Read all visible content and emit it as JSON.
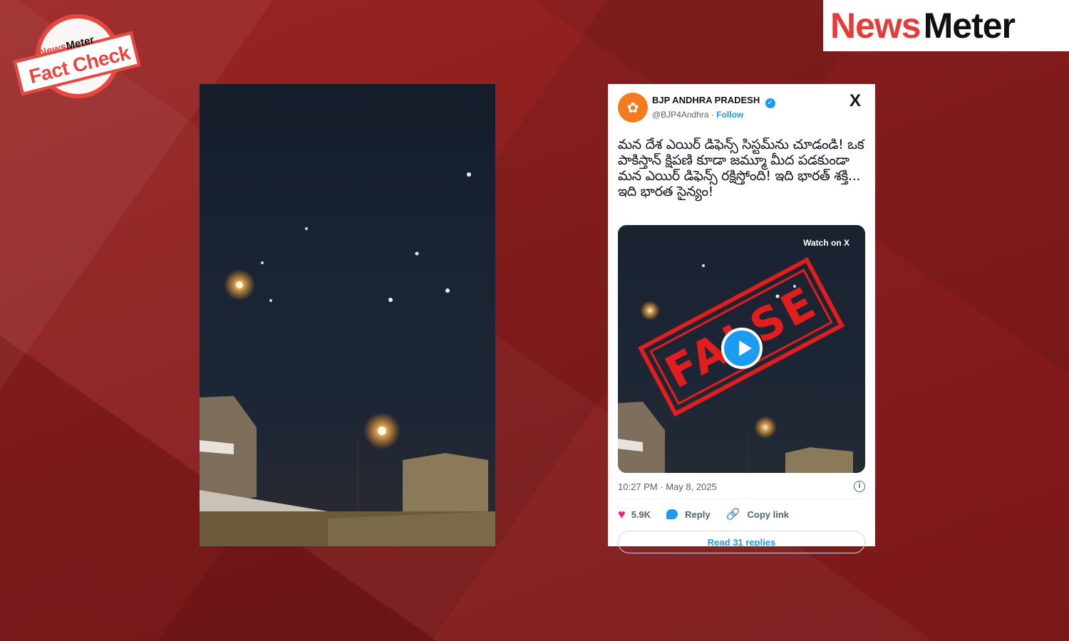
{
  "stamp": {
    "brand_news": "News",
    "brand_meter": "Meter",
    "label": "Fact Check"
  },
  "logo": {
    "news": "News",
    "meter": "Meter"
  },
  "tweet": {
    "account_name": "BJP ANDHRA PRADESH",
    "handle": "@BJP4Andhra",
    "separator": " · ",
    "follow_label": "Follow",
    "x_icon": "X",
    "text": "మన దేశ ఎయిర్ డిఫెన్స్ సిస్టమ్‌ను చూడండి! ఒక పాకిస్తాన్ క్షిపణి కూడా జమ్మూ మీద పడకుండా మన ఎయిర్ డిఫెన్స్ రక్షిస్తోంది! ఇది భారత్ శక్తి... ఇది భారత సైన్యం!",
    "watch_label": "Watch on X",
    "false_label": "FALSE",
    "timestamp": "10:27 PM · May 8, 2025",
    "likes": "5.9K",
    "reply_label": "Reply",
    "copy_link_label": "Copy link",
    "read_replies_label": "Read 31 replies"
  },
  "colors": {
    "background": "#8a1d1e",
    "brand_red": "#e43b3b",
    "twitter_blue": "#1d9bf0",
    "like_pink": "#f91880",
    "false_red": "#e11d1d"
  }
}
